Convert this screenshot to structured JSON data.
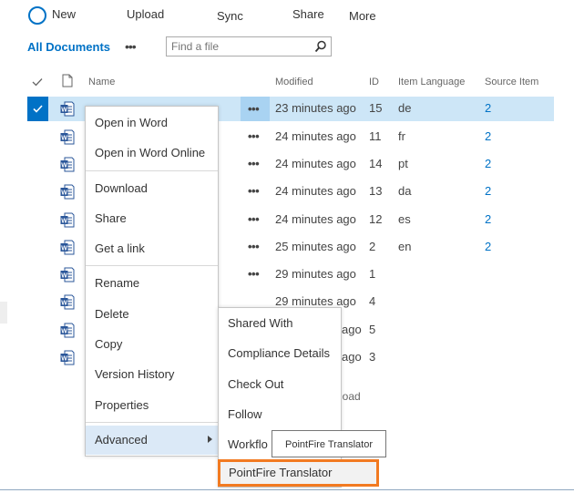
{
  "toolbar": {
    "new": "New",
    "upload": "Upload",
    "sync": "Sync",
    "share": "Share",
    "more": "More"
  },
  "view": {
    "name": "All Documents",
    "dots": "•••"
  },
  "search": {
    "placeholder": "Find a file"
  },
  "columns": {
    "name": "Name",
    "modified": "Modified",
    "id": "ID",
    "item_language": "Item Language",
    "source_item": "Source Item"
  },
  "rows": [
    {
      "modified": "23 minutes ago",
      "id": "15",
      "lang": "de",
      "source": "2",
      "selected": true
    },
    {
      "modified": "24 minutes ago",
      "id": "11",
      "lang": "fr",
      "source": "2"
    },
    {
      "modified": "24 minutes ago",
      "id": "14",
      "lang": "pt",
      "source": "2"
    },
    {
      "modified": "24 minutes ago",
      "id": "13",
      "lang": "da",
      "source": "2"
    },
    {
      "modified": "24 minutes ago",
      "id": "12",
      "lang": "es",
      "source": "2"
    },
    {
      "modified": "25 minutes ago",
      "id": "2",
      "lang": "en",
      "source": "2"
    },
    {
      "modified": "29 minutes ago",
      "id": "1",
      "lang": "",
      "source": ""
    },
    {
      "modified": "29 minutes ago",
      "id": "4",
      "lang": "",
      "source": ""
    },
    {
      "modified": "ago",
      "id": "5",
      "lang": "",
      "source": ""
    },
    {
      "modified": "ago",
      "id": "3",
      "lang": "",
      "source": ""
    }
  ],
  "drag_hint_fragment": "load",
  "context_menu": {
    "open_in_word": "Open in Word",
    "open_in_word_online": "Open in Word Online",
    "download": "Download",
    "share": "Share",
    "get_a_link": "Get a link",
    "rename": "Rename",
    "delete": "Delete",
    "copy": "Copy",
    "version_history": "Version History",
    "properties": "Properties",
    "advanced": "Advanced"
  },
  "advanced_menu": {
    "shared_with": "Shared With",
    "compliance_details": "Compliance Details",
    "check_out": "Check Out",
    "follow": "Follow",
    "workflow": "Workflo",
    "pointfire_translator": "PointFire Translator"
  },
  "tooltip": "PointFire Translator",
  "colors": {
    "accent": "#0072c6",
    "selection": "#cde6f7",
    "highlight_border": "#f27a21"
  },
  "icons": {
    "doc": "word-doc-icon",
    "search": "magnifier-icon",
    "check": "checkmark-icon"
  }
}
